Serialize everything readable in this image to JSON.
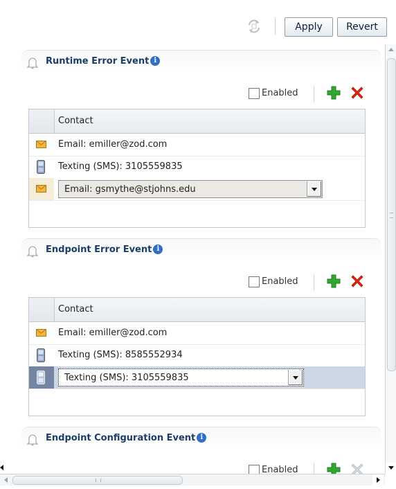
{
  "toolbar": {
    "refresh_icon": "refresh-icon",
    "apply_label": "Apply",
    "revert_label": "Revert"
  },
  "sections": [
    {
      "title": "Runtime Error Event",
      "info_icon": "i",
      "enabled_label": "Enabled",
      "enabled_checked": false,
      "column_header": "Contact",
      "rows": [
        {
          "icon": "envelope-icon",
          "text": "Email: emiller@zod.com"
        },
        {
          "icon": "phone-icon",
          "text": "Texting (SMS): 3105559835"
        }
      ],
      "edit_row": {
        "icon": "envelope-icon",
        "value": "Email: gsmythe@stjohns.edu"
      }
    },
    {
      "title": "Endpoint Error Event",
      "info_icon": "i",
      "enabled_label": "Enabled",
      "enabled_checked": false,
      "column_header": "Contact",
      "rows": [
        {
          "icon": "envelope-icon",
          "text": "Email: emiller@zod.com"
        },
        {
          "icon": "phone-icon",
          "text": "Texting (SMS): 8585552934"
        }
      ],
      "edit_row": {
        "icon": "phone-icon",
        "value": "Texting (SMS): 3105559835"
      }
    },
    {
      "title": "Endpoint Configuration Event",
      "info_icon": "i",
      "enabled_label": "Enabled",
      "enabled_checked": false
    }
  ],
  "colors": {
    "section_title": "#1c3d64",
    "info_icon": "#2f6fca",
    "add_icon": "#2fa82f",
    "delete_icon": "#e02a10",
    "delete_icon_disabled": "#b8bcc1",
    "selected_row": "#cdd6e4"
  }
}
